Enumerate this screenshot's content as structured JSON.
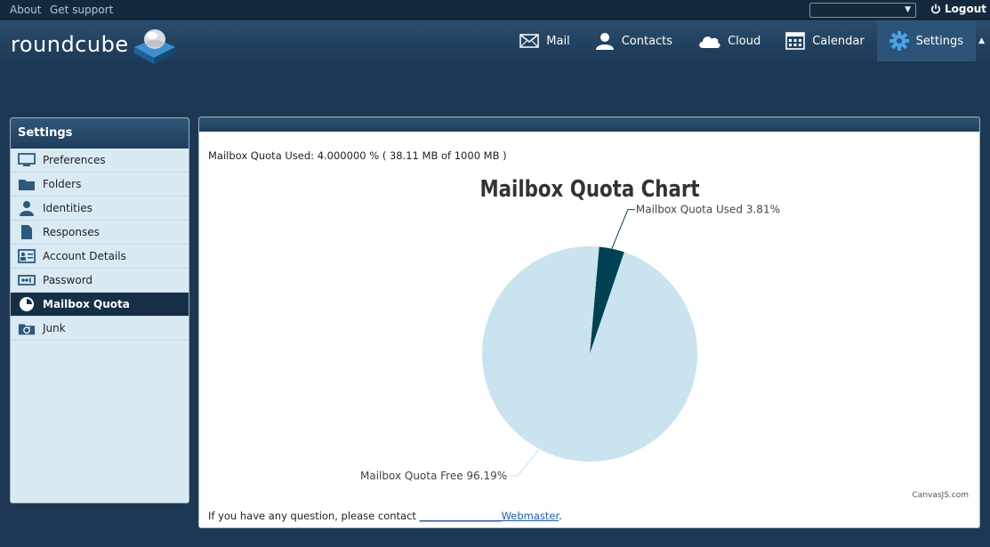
{
  "topbar": {
    "about": "About",
    "support": "Get support",
    "account_value": "",
    "logout": "Logout"
  },
  "header": {
    "logo_text": "roundcube",
    "nav": [
      {
        "label": "Mail",
        "icon": "envelope-icon"
      },
      {
        "label": "Contacts",
        "icon": "person-icon"
      },
      {
        "label": "Cloud",
        "icon": "cloud-icon"
      },
      {
        "label": "Calendar",
        "icon": "calendar-icon"
      },
      {
        "label": "Settings",
        "icon": "gear-icon",
        "selected": true
      }
    ]
  },
  "sidebar": {
    "title": "Settings",
    "items": [
      {
        "label": "Preferences",
        "icon": "monitor-icon"
      },
      {
        "label": "Folders",
        "icon": "folder-icon"
      },
      {
        "label": "Identities",
        "icon": "person-icon"
      },
      {
        "label": "Responses",
        "icon": "document-icon"
      },
      {
        "label": "Account Details",
        "icon": "id-card-icon"
      },
      {
        "label": "Password",
        "icon": "password-icon"
      },
      {
        "label": "Mailbox Quota",
        "icon": "pie-icon",
        "active": true
      },
      {
        "label": "Junk",
        "icon": "recycle-icon"
      }
    ]
  },
  "content": {
    "quota_text": "Mailbox Quota Used: 4.000000 % ( 38.11 MB of 1000 MB )",
    "help_prefix": "If you have any question, please contact ",
    "help_spacer": "________________",
    "help_link": "Webmaster",
    "help_suffix": "."
  },
  "chart_data": {
    "type": "pie",
    "title": "Mailbox Quota Chart",
    "credit": "CanvasJS.com",
    "slices": [
      {
        "name": "Mailbox Quota Used",
        "value": 3.81,
        "label": "Mailbox Quota Used 3.81%",
        "color": "#004254"
      },
      {
        "name": "Mailbox Quota Free",
        "value": 96.19,
        "label": "Mailbox Quota Free 96.19%",
        "color": "#c9e3ef"
      }
    ]
  },
  "colors": {
    "background": "#1d3852",
    "active_item": "#172f46",
    "link": "#1e5b9e"
  }
}
